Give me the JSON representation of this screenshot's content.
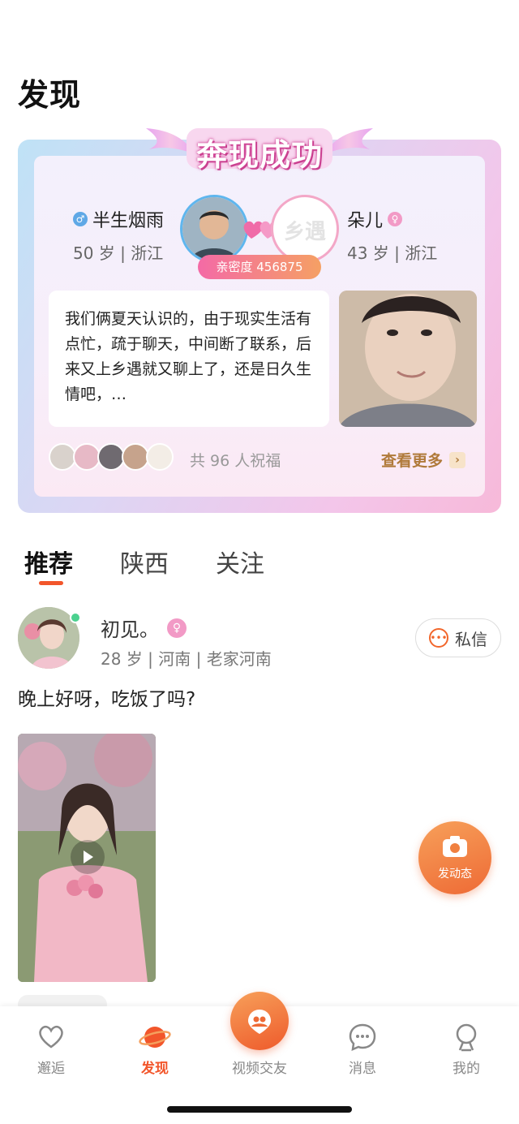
{
  "page": {
    "title": "发现"
  },
  "success_card": {
    "banner": "奔现成功",
    "left_user": {
      "name": "半生烟雨",
      "info": "50 岁 | 浙江",
      "gender": "male"
    },
    "right_user": {
      "name": "朵儿",
      "info": "43 岁 | 浙江",
      "gender": "female",
      "avatar_text": "乡遇"
    },
    "intimacy": "亲密度 456875",
    "story": "我们俩夏天认识的，由于现实生活有点忙，疏于聊天，中间断了联系，后来又上乡遇就又聊上了，还是日久生情吧，…",
    "blessings": "共 96 人祝福",
    "see_more": "查看更多",
    "colors": {
      "accent_pink": "#f46aa6",
      "accent_orange": "#f5a064"
    }
  },
  "tabs": [
    {
      "label": "推荐",
      "active": true
    },
    {
      "label": "陕西",
      "active": false
    },
    {
      "label": "关注",
      "active": false
    }
  ],
  "post": {
    "name": "初见。",
    "gender": "female",
    "info": "28 岁 | 河南 | 老家河南",
    "text": "晚上好呀，吃饭了吗?",
    "dm_label": "私信"
  },
  "fab": {
    "label": "发动态"
  },
  "bottom_nav": [
    {
      "label": "邂逅",
      "icon": "heart-chat-icon",
      "active": false
    },
    {
      "label": "发现",
      "icon": "planet-icon",
      "active": true
    },
    {
      "label": "视频交友",
      "icon": "video-friends-icon",
      "active": false
    },
    {
      "label": "消息",
      "icon": "message-icon",
      "active": false
    },
    {
      "label": "我的",
      "icon": "profile-icon",
      "active": false
    }
  ],
  "brand_color": "#f2562b"
}
